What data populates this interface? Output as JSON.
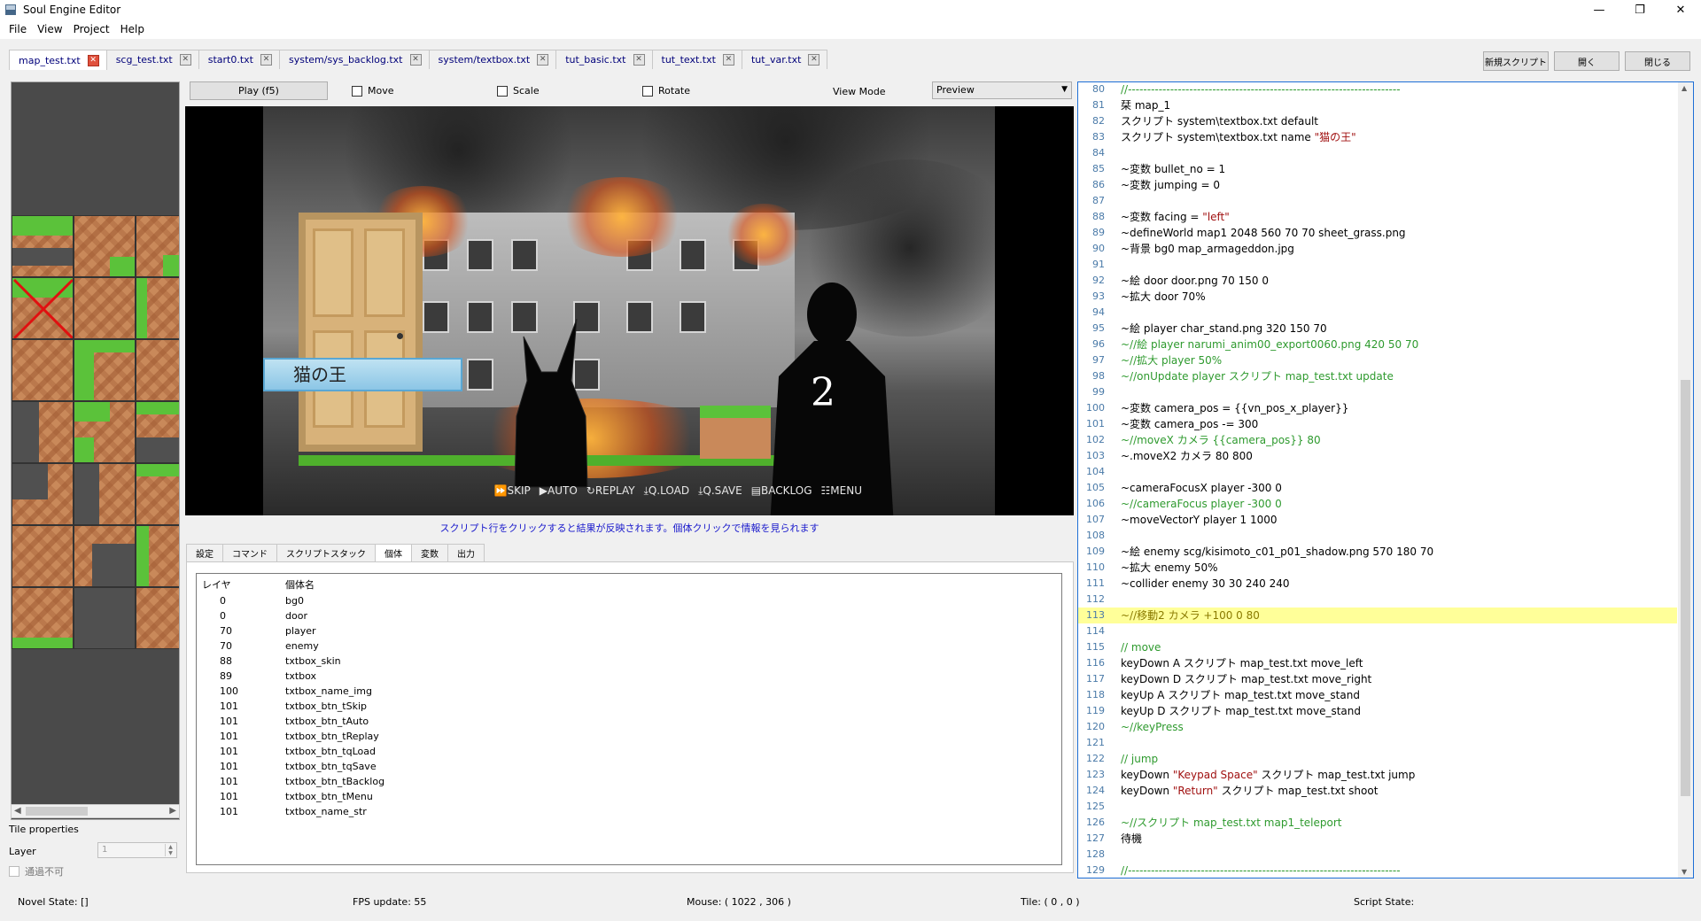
{
  "window": {
    "title": "Soul Engine Editor",
    "min": "—",
    "max": "❐",
    "close": "✕"
  },
  "menu": [
    "File",
    "View",
    "Project",
    "Help"
  ],
  "tabs": [
    "map_test.txt",
    "scg_test.txt",
    "start0.txt",
    "system/sys_backlog.txt",
    "system/textbox.txt",
    "tut_basic.txt",
    "tut_text.txt",
    "tut_var.txt"
  ],
  "top_buttons": {
    "new_script": "新規スクリプト",
    "open": "開く",
    "close": "閉じる"
  },
  "toolbar": {
    "play": "Play (f5)",
    "move": "Move",
    "scale": "Scale",
    "rotate": "Rotate",
    "view_mode_label": "View Mode",
    "view_mode_value": "Preview"
  },
  "preview": {
    "name_box": "猫の王",
    "character_number": "2",
    "game_buttons": [
      "⏩SKIP",
      "▶AUTO",
      "↻REPLAY",
      "⤓Q.LOAD",
      "⤓Q.SAVE",
      "▤BACKLOG",
      "☷MENU"
    ]
  },
  "hint": "スクリプト行をクリックすると結果が反映されます。個体クリックで情報を見られます",
  "bottom_tabs": [
    "設定",
    "コマンド",
    "スクリプトスタック",
    "個体",
    "変数",
    "出力"
  ],
  "object_table": {
    "headers": [
      "レイヤ",
      "個体名"
    ],
    "rows": [
      [
        "0",
        "bg0"
      ],
      [
        "0",
        "door"
      ],
      [
        "70",
        "player"
      ],
      [
        "70",
        "enemy"
      ],
      [
        "88",
        "txtbox_skin"
      ],
      [
        "89",
        "txtbox"
      ],
      [
        "100",
        "txtbox_name_img"
      ],
      [
        "101",
        "txtbox_btn_tSkip"
      ],
      [
        "101",
        "txtbox_btn_tAuto"
      ],
      [
        "101",
        "txtbox_btn_tReplay"
      ],
      [
        "101",
        "txtbox_btn_tqLoad"
      ],
      [
        "101",
        "txtbox_btn_tqSave"
      ],
      [
        "101",
        "txtbox_btn_tBacklog"
      ],
      [
        "101",
        "txtbox_btn_tMenu"
      ],
      [
        "101",
        "txtbox_name_str"
      ]
    ]
  },
  "tile_properties": {
    "title": "Tile properties",
    "layer_label": "Layer",
    "layer_value": "1",
    "no_pass": "通過不可"
  },
  "code_lines": [
    [
      "80",
      "//-----------------------------------------------------------------------",
      "comment"
    ],
    [
      "81",
      "栞 map_1",
      ""
    ],
    [
      "82",
      "スクリプト system\\textbox.txt default",
      ""
    ],
    [
      "83",
      "スクリプト system\\textbox.txt name ",
      "str:\"猫の王\""
    ],
    [
      "84",
      "",
      ""
    ],
    [
      "85",
      "~変数 bullet_no = 1",
      ""
    ],
    [
      "86",
      "~変数 jumping = 0",
      ""
    ],
    [
      "87",
      "",
      ""
    ],
    [
      "88",
      "~変数 facing = ",
      "str:\"left\""
    ],
    [
      "89",
      "~defineWorld map1 2048 560 70 70 sheet_grass.png",
      ""
    ],
    [
      "90",
      "~背景 bg0 map_armageddon.jpg",
      ""
    ],
    [
      "91",
      "",
      ""
    ],
    [
      "92",
      "~絵 door door.png 70 150 0",
      ""
    ],
    [
      "93",
      "~拡大 door 70%",
      ""
    ],
    [
      "94",
      "",
      ""
    ],
    [
      "95",
      "~絵 player char_stand.png 320 150 70",
      ""
    ],
    [
      "96",
      "~//絵 player narumi_anim00_export0060.png 420 50 70",
      "comment"
    ],
    [
      "97",
      "~//拡大 player 50%",
      "comment"
    ],
    [
      "98",
      "~//onUpdate player スクリプト map_test.txt update",
      "comment"
    ],
    [
      "99",
      "",
      ""
    ],
    [
      "100",
      "~変数 camera_pos = {{vn_pos_x_player}}",
      ""
    ],
    [
      "101",
      "~変数 camera_pos -= 300",
      ""
    ],
    [
      "102",
      "~//moveX カメラ {{camera_pos}} 80",
      "comment"
    ],
    [
      "103",
      "~.moveX2 カメラ 80 800",
      ""
    ],
    [
      "104",
      "",
      ""
    ],
    [
      "105",
      "~cameraFocusX player -300 0",
      ""
    ],
    [
      "106",
      "~//cameraFocus player -300 0",
      "comment"
    ],
    [
      "107",
      "~moveVectorY player 1 1000",
      ""
    ],
    [
      "108",
      "",
      ""
    ],
    [
      "109",
      "~絵 enemy scg/kisimoto_c01_p01_shadow.png 570 180 70",
      ""
    ],
    [
      "110",
      "~拡大 enemy 50%",
      ""
    ],
    [
      "111",
      "~collider enemy 30 30 240 240",
      ""
    ],
    [
      "112",
      "",
      ""
    ],
    [
      "113",
      "~//移動2 カメラ +100 0 80",
      "hl"
    ],
    [
      "114",
      "",
      ""
    ],
    [
      "115",
      "// move",
      "comment"
    ],
    [
      "116",
      "keyDown A スクリプト map_test.txt move_left",
      ""
    ],
    [
      "117",
      "keyDown D スクリプト map_test.txt move_right",
      ""
    ],
    [
      "118",
      "keyUp A スクリプト map_test.txt move_stand",
      ""
    ],
    [
      "119",
      "keyUp D スクリプト map_test.txt move_stand",
      ""
    ],
    [
      "120",
      "~//keyPress",
      "comment"
    ],
    [
      "121",
      "",
      ""
    ],
    [
      "122",
      "// jump",
      "comment"
    ],
    [
      "123",
      "keyDown ",
      "str:\"Keypad Space\"| スクリプト map_test.txt jump"
    ],
    [
      "124",
      "keyDown ",
      "str:\"Return\"| スクリプト map_test.txt shoot"
    ],
    [
      "125",
      "",
      ""
    ],
    [
      "126",
      "~//スクリプト map_test.txt map1_teleport",
      "comment"
    ],
    [
      "127",
      "待機",
      ""
    ],
    [
      "128",
      "",
      ""
    ],
    [
      "129",
      "//-----------------------------------------------------------------------",
      "comment"
    ]
  ],
  "status": {
    "novel_state": "Novel State: []",
    "fps": "FPS update: 55",
    "mouse": "Mouse: ( 1022 , 306 )",
    "tile": "Tile: ( 0 , 0 )",
    "script_state": "Script State:"
  }
}
